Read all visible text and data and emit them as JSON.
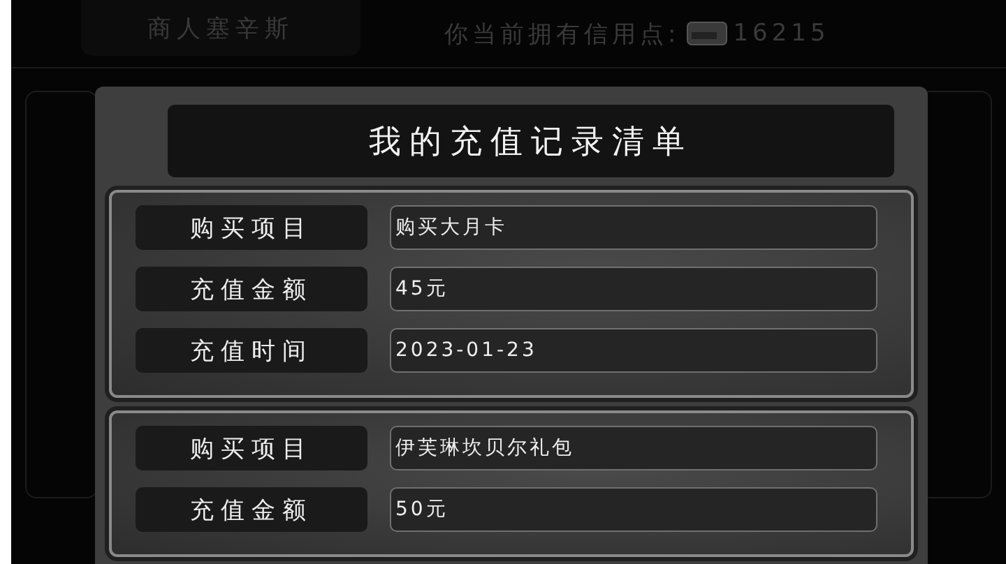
{
  "header": {
    "merchant_tab": "商人塞辛斯",
    "credit_label": "你当前拥有信用点:",
    "credits": "16215"
  },
  "dialog": {
    "title": "我的充值记录清单",
    "records": [
      {
        "rows": [
          {
            "label": "购买项目",
            "value": "购买大月卡"
          },
          {
            "label": "充值金额",
            "value": "45元"
          },
          {
            "label": "充值时间",
            "value": "2023-01-23"
          }
        ]
      },
      {
        "rows": [
          {
            "label": "购买项目",
            "value": "伊芙琳坎贝尔礼包"
          },
          {
            "label": "充值金额",
            "value": "50元"
          }
        ]
      }
    ]
  }
}
